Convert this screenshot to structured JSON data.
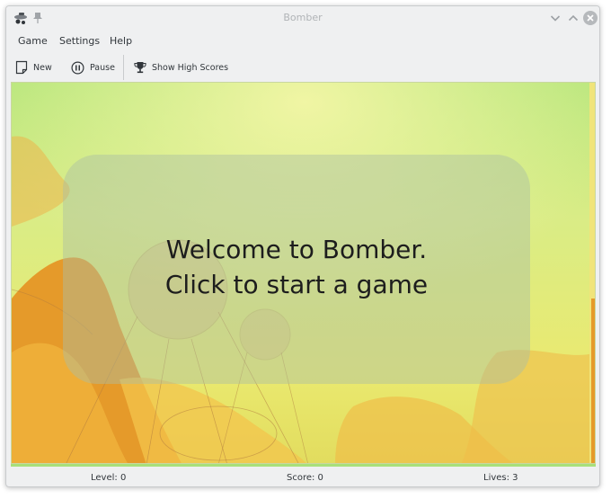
{
  "window": {
    "title": "Bomber"
  },
  "menu": {
    "game": "Game",
    "settings": "Settings",
    "help": "Help"
  },
  "toolbar": {
    "new_label": "New",
    "pause_label": "Pause",
    "scores_label": "Show High Scores"
  },
  "game": {
    "welcome_line1": "Welcome to Bomber.",
    "welcome_line2": "Click to start a game"
  },
  "status": {
    "level": "Level: 0",
    "score": "Score: 0",
    "lives": "Lives: 3"
  },
  "icons": {
    "app": "bomber-app-icon",
    "pin": "pin-icon",
    "minimize": "chevron-down-icon",
    "maximize": "chevron-up-icon",
    "close": "close-icon",
    "new": "new-document-icon",
    "pause": "pause-icon",
    "scores": "trophy-icon"
  },
  "colors": {
    "accent": "#3daee9",
    "background": "#eff0f1",
    "text": "#31363b",
    "title_inactive": "#b0b3b6"
  }
}
